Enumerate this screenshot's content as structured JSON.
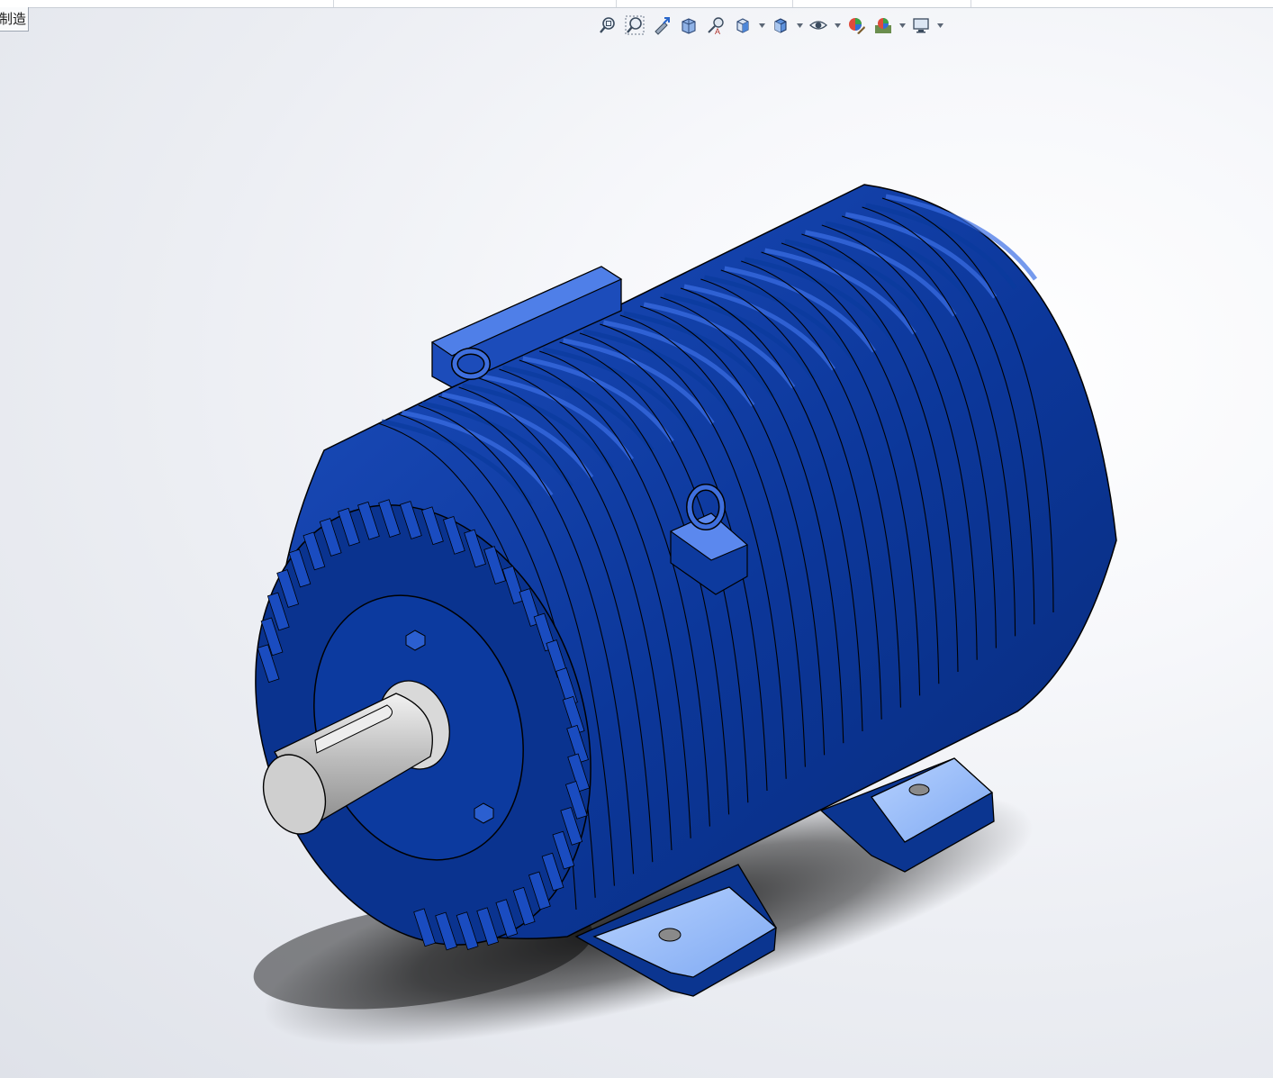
{
  "document_tab": {
    "label": "制造"
  },
  "heads_up_toolbar": [
    {
      "icon": "zoom-to-fit-icon"
    },
    {
      "icon": "zoom-to-area-icon"
    },
    {
      "icon": "previous-view-icon"
    },
    {
      "icon": "section-view-icon"
    },
    {
      "icon": "dynamic-annotation-views-icon"
    },
    {
      "icon": "view-orientation-icon",
      "dropdown": true
    },
    {
      "icon": "display-style-icon",
      "dropdown": true
    },
    {
      "icon": "hide-show-items-icon",
      "dropdown": true
    },
    {
      "icon": "edit-appearance-icon"
    },
    {
      "icon": "apply-scene-icon",
      "dropdown": true
    },
    {
      "icon": "view-settings-icon",
      "dropdown": true
    }
  ],
  "model": {
    "body_color": "#0a3a9c",
    "fin_highlight": "#3c6fe6",
    "shaft_color": "#c8c8c8"
  }
}
